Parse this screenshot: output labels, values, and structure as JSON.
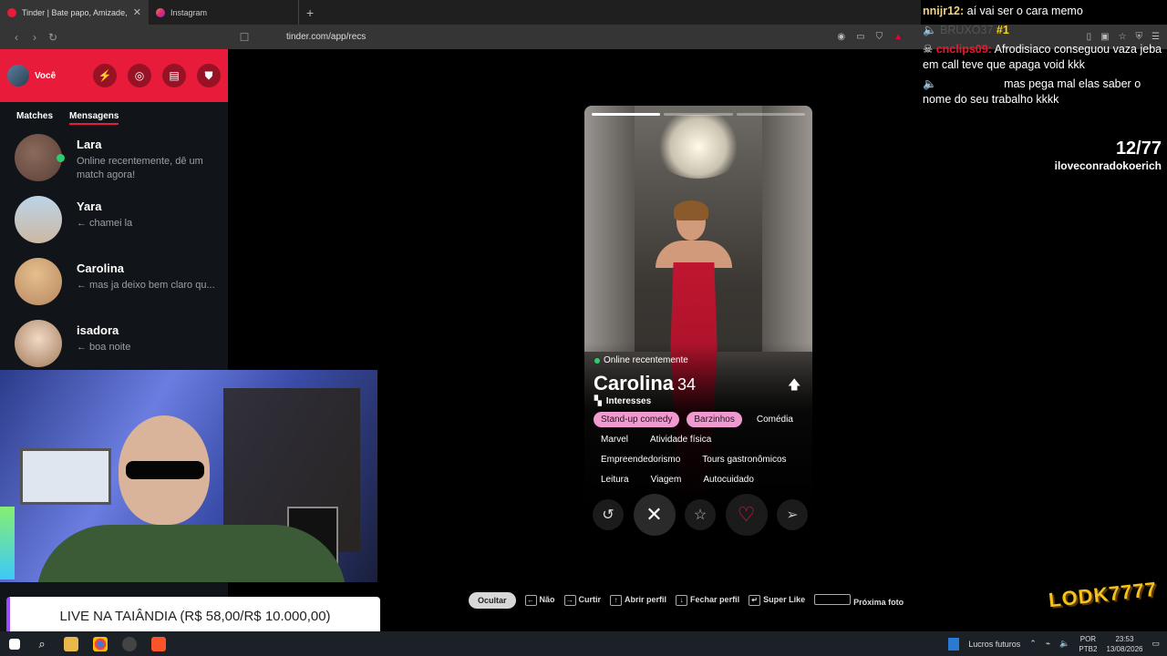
{
  "browser": {
    "tabs": [
      {
        "title": "Tinder | Bate papo, Amizade, En",
        "active": true
      },
      {
        "title": "Instagram",
        "active": false
      }
    ],
    "url": "tinder.com/app/recs"
  },
  "sidebar": {
    "user_label": "Você",
    "tabs": [
      "Matches",
      "Mensagens"
    ],
    "conversations": [
      {
        "name": "Lara",
        "message": "Online recentemente, dê um match agora!",
        "online": true
      },
      {
        "name": "Yara",
        "message": "← chamei la"
      },
      {
        "name": "Carolina",
        "message": "← mas ja deixo bem claro qu..."
      },
      {
        "name": "isadora",
        "message": "← boa noite"
      }
    ]
  },
  "profile": {
    "status": "Online recentemente",
    "name": "Carolina",
    "age": "34",
    "interests_label": "Interesses",
    "interests": [
      {
        "label": "Stand-up comedy",
        "shared": true
      },
      {
        "label": "Barzinhos",
        "shared": true
      },
      {
        "label": "Comédia",
        "shared": false
      },
      {
        "label": "Marvel",
        "shared": false
      },
      {
        "label": "Atividade física",
        "shared": false
      },
      {
        "label": "Empreendedorismo",
        "shared": false
      },
      {
        "label": "Tours gastronômicos",
        "shared": false
      },
      {
        "label": "Leitura",
        "shared": false
      },
      {
        "label": "Viagem",
        "shared": false
      },
      {
        "label": "Autocuidado",
        "shared": false
      }
    ]
  },
  "hints": {
    "hide": "Ocultar",
    "no": "Não",
    "like": "Curtir",
    "open_profile": "Abrir perfil",
    "close_profile": "Fechar perfil",
    "super_like": "Super Like",
    "next_photo": "Próxima foto"
  },
  "overlay": {
    "chat": [
      {
        "user": "nnijr12:",
        "text": "aí vai ser o cara memo"
      },
      {
        "user": "BRUXO37",
        "text": "",
        "rank": "#1"
      },
      {
        "user": "cnclips09:",
        "text": "Afrodisiaco conseguou vaza jeba em call teve que apaga void kkk"
      },
      {
        "user": "",
        "text": "mas pega mal elas saber o nome do seu trabalho kkkk"
      }
    ],
    "counter": "12/77",
    "handle": "iloveconradokoerich",
    "banner": "LIVE NA TAIÂNDIA (R$ 58,00/R$ 10.000,00)",
    "logo": "LODK7777"
  },
  "taskbar": {
    "app": "Lucros futuros",
    "lang1": "POR",
    "lang2": "PTB2",
    "time": "23:53",
    "date": "13/08/2026"
  }
}
